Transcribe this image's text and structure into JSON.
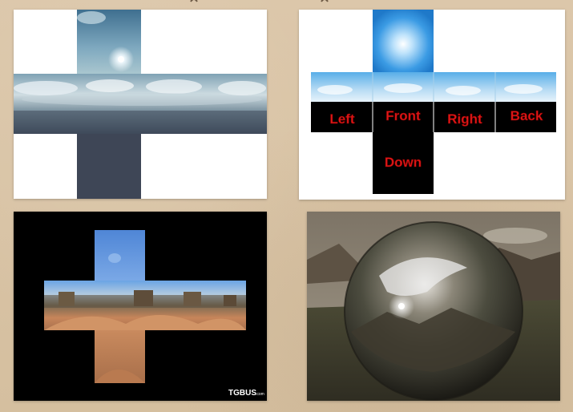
{
  "panels": [
    {
      "id": "sky-cross",
      "description_icon": "skybox-cross-cloud-icon"
    },
    {
      "id": "face-layout",
      "description_icon": "skybox-face-layout-icon"
    },
    {
      "id": "desert-cross",
      "description_icon": "skybox-cross-desert-icon"
    },
    {
      "id": "mirror-sphere",
      "description_icon": "reflective-sphere-icon"
    }
  ],
  "face_labels": {
    "left": "Left",
    "front": "Front",
    "right": "Right",
    "back": "Back",
    "down": "Down"
  },
  "watermark": {
    "text": "TGBUS",
    "suffix": ".com"
  },
  "colors": {
    "background": "#d9c4a6",
    "label_red": "#e01818",
    "sky_blue": "#4aa3e6",
    "ground_slate": "#3e4656"
  }
}
